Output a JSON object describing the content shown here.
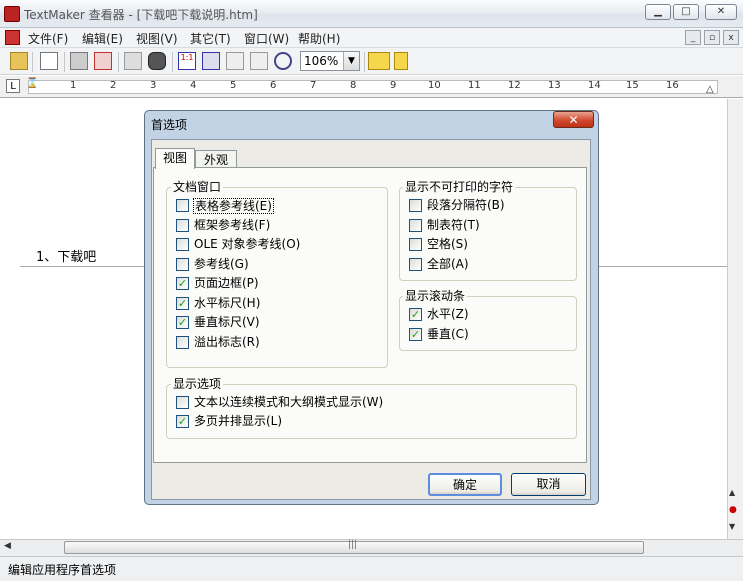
{
  "window": {
    "title": "TextMaker 查看器 - [下载吧下载说明.htm]"
  },
  "menu": [
    "文件(F)",
    "编辑(E)",
    "视图(V)",
    "其它(T)",
    "窗口(W)",
    "帮助(H)"
  ],
  "toolbar": {
    "zoom": "106%"
  },
  "ruler": {
    "numbers": [
      "1",
      "2",
      "3",
      "4",
      "5",
      "6",
      "7",
      "8",
      "9",
      "10",
      "11",
      "12",
      "13",
      "14",
      "15",
      "16"
    ]
  },
  "document": {
    "text": "1、下载吧"
  },
  "status": {
    "text": "编辑应用程序首选项"
  },
  "dialog": {
    "title": "首选项",
    "close": "✕",
    "tabs": [
      "视图",
      "外观"
    ],
    "doc_window": {
      "title": "文档窗口",
      "items": [
        {
          "label": "表格参考线(E)",
          "checked": false
        },
        {
          "label": "框架参考线(F)",
          "checked": false
        },
        {
          "label": "OLE 对象参考线(O)",
          "checked": false
        },
        {
          "label": "参考线(G)",
          "checked": false
        },
        {
          "label": "页面边框(P)",
          "checked": true
        },
        {
          "label": "水平标尺(H)",
          "checked": true
        },
        {
          "label": "垂直标尺(V)",
          "checked": true
        },
        {
          "label": "溢出标志(R)",
          "checked": false
        }
      ]
    },
    "nonprint": {
      "title": "显示不可打印的字符",
      "items": [
        {
          "label": "段落分隔符(B)",
          "checked": false
        },
        {
          "label": "制表符(T)",
          "checked": false
        },
        {
          "label": "空格(S)",
          "checked": false
        },
        {
          "label": "全部(A)",
          "checked": false
        }
      ]
    },
    "scrollbars": {
      "title": "显示滚动条",
      "items": [
        {
          "label": "水平(Z)",
          "checked": true
        },
        {
          "label": "垂直(C)",
          "checked": true
        }
      ]
    },
    "display": {
      "title": "显示选项",
      "items": [
        {
          "label": "文本以连续模式和大纲模式显示(W)",
          "checked": false
        },
        {
          "label": "多页并排显示(L)",
          "checked": true
        }
      ]
    },
    "ok": "确定",
    "cancel": "取消"
  }
}
